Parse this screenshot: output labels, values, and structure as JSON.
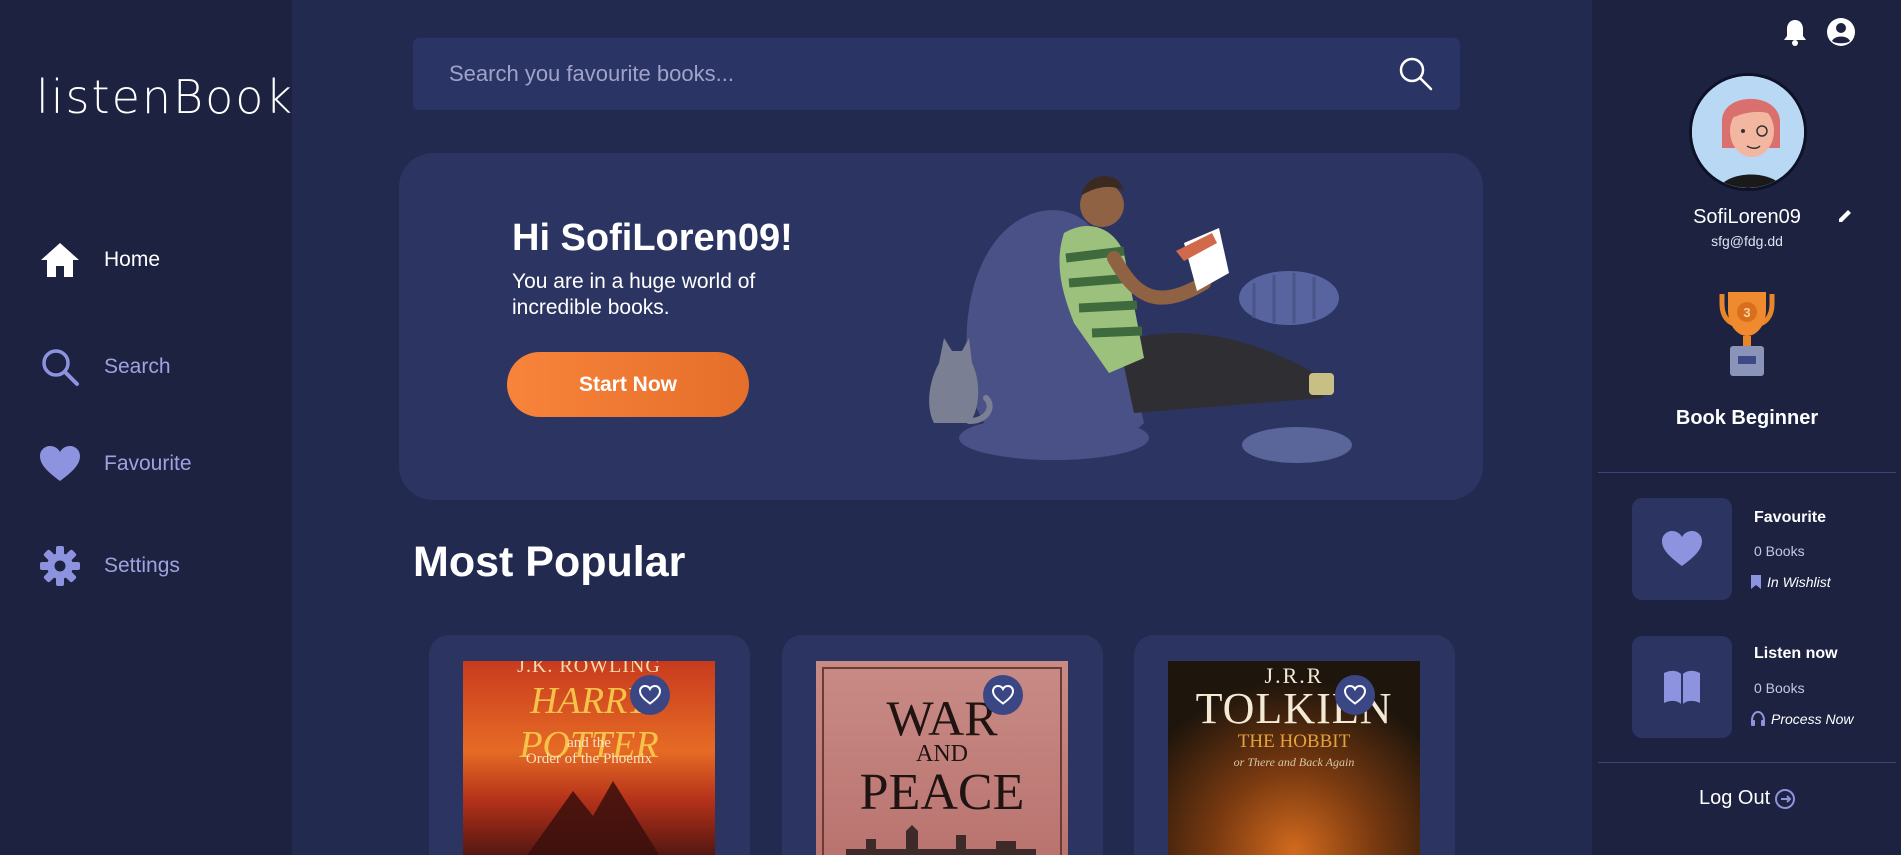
{
  "brand": {
    "logo": "listenBook"
  },
  "nav": [
    {
      "label": "Home",
      "icon": "home-icon"
    },
    {
      "label": "Search",
      "icon": "search-icon"
    },
    {
      "label": "Favourite",
      "icon": "heart-icon"
    },
    {
      "label": "Settings",
      "icon": "gear-icon"
    }
  ],
  "search": {
    "placeholder": "Search you favourite books..."
  },
  "hero": {
    "title": "Hi SofiLoren09!",
    "subtitle": "You are in a huge world of incredible books.",
    "cta": "Start Now"
  },
  "popular": {
    "title": "Most Popular",
    "books": [
      {
        "cover_lines": [
          "J.K. ROWLING",
          "HARRY POTTER",
          "and the",
          "Order of the Phoenix"
        ]
      },
      {
        "cover_lines": [
          "WAR",
          "AND",
          "PEACE"
        ]
      },
      {
        "cover_lines": [
          "J.R.R",
          "TOLKIEN",
          "THE HOBBIT",
          "or There and Back Again"
        ]
      }
    ]
  },
  "profile": {
    "username": "SofiLoren09",
    "email": "sfg@fdg.dd",
    "rank": "Book Beginner",
    "rank_badge": "3"
  },
  "stats": [
    {
      "title": "Favourite",
      "count": "0 Books",
      "link": "In Wishlist",
      "icon": "heart-icon",
      "link_icon": "bookmark-icon"
    },
    {
      "title": "Listen now",
      "count": "0 Books",
      "link": "Process Now",
      "icon": "open-book-icon",
      "link_icon": "headphones-icon"
    }
  ],
  "logout": {
    "label": "Log Out"
  },
  "colors": {
    "accent": "#f8833a",
    "nav_muted": "#9ea3e0",
    "icon": "#8e93df"
  }
}
